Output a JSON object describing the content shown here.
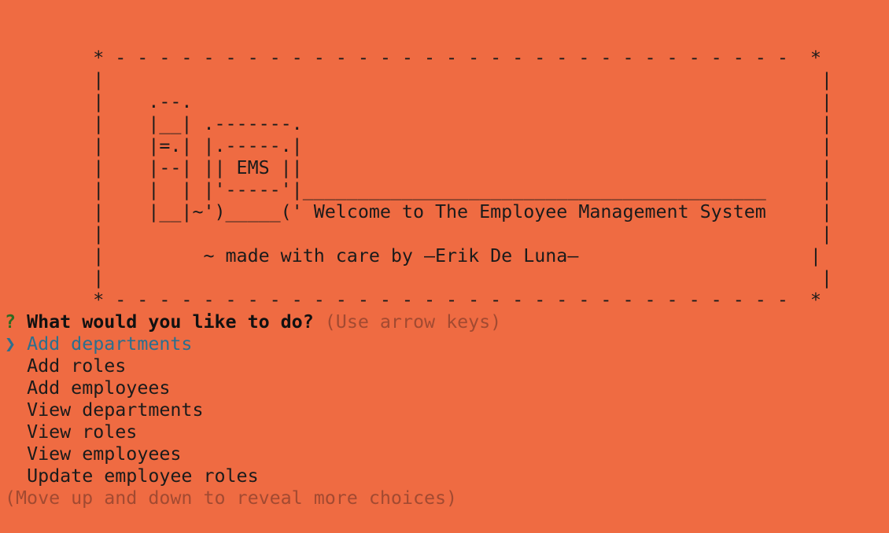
{
  "banner": {
    "lines": [
      "        * - - - - - - - - - - - - - - - - - - - - - - - - - - - - - - -  *",
      "        |                                                                 |",
      "        |    .--.                                                         |",
      "        |    |__| .-------.                                               |",
      "        |    |=.| |.-----.|                                               |",
      "        |    |--| || EMS ||                                               |",
      "        |    |  | |'-----'|__________________________________________     |",
      "        |    |__|~')_____(' Welcome to The Employee Management System     |",
      "        |                                                                 |",
      "        |         ~ made with care by –Erik De Luna–                     |",
      "        |                                                                 |",
      "        * - - - - - - - - - - - - - - - - - - - - - - - - - - - - - - -  *"
    ]
  },
  "prompt": {
    "marker": "?",
    "question": "What would you like to do?",
    "hint": "(Use arrow keys)"
  },
  "choices": {
    "pointer": "❯",
    "items": [
      "Add departments",
      "Add roles",
      "Add employees",
      "View departments",
      "View roles",
      "View employees",
      "Update employee roles"
    ]
  },
  "footer_hint": "(Move up and down to reveal more choices)",
  "colors": {
    "background": "#ef6b42",
    "text": "#1b1b1b",
    "selected": "#2c6f8e",
    "question_mark": "#2f6b22",
    "muted": "#a24a31"
  }
}
